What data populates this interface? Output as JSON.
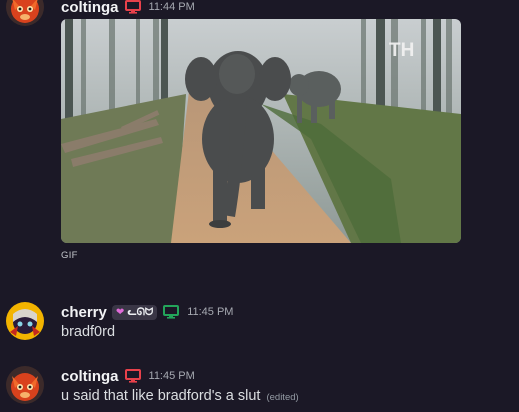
{
  "messages": [
    {
      "username": "coltinga",
      "timestamp": "11:44 PM",
      "device_icon": "desktop-icon",
      "device_color": "#e8414b",
      "attachment": {
        "type": "gif",
        "label": "GIF",
        "watermark": "TH"
      }
    },
    {
      "username": "cherry",
      "badge": "ᓚᘏᗢ",
      "badge_icon": "heart-icon",
      "timestamp": "11:45 PM",
      "device_icon": "desktop-icon",
      "device_color": "#23a55a",
      "text": "bradf0rd"
    },
    {
      "username": "coltinga",
      "timestamp": "11:45 PM",
      "device_icon": "desktop-icon",
      "device_color": "#e8414b",
      "text": "u said that like bradford's a slut",
      "edited_label": "(edited)"
    }
  ],
  "colors": {
    "background": "#1b1826",
    "username": "#f2f3f5",
    "timestamp": "#a6a9b1",
    "text": "#dbdee1"
  }
}
